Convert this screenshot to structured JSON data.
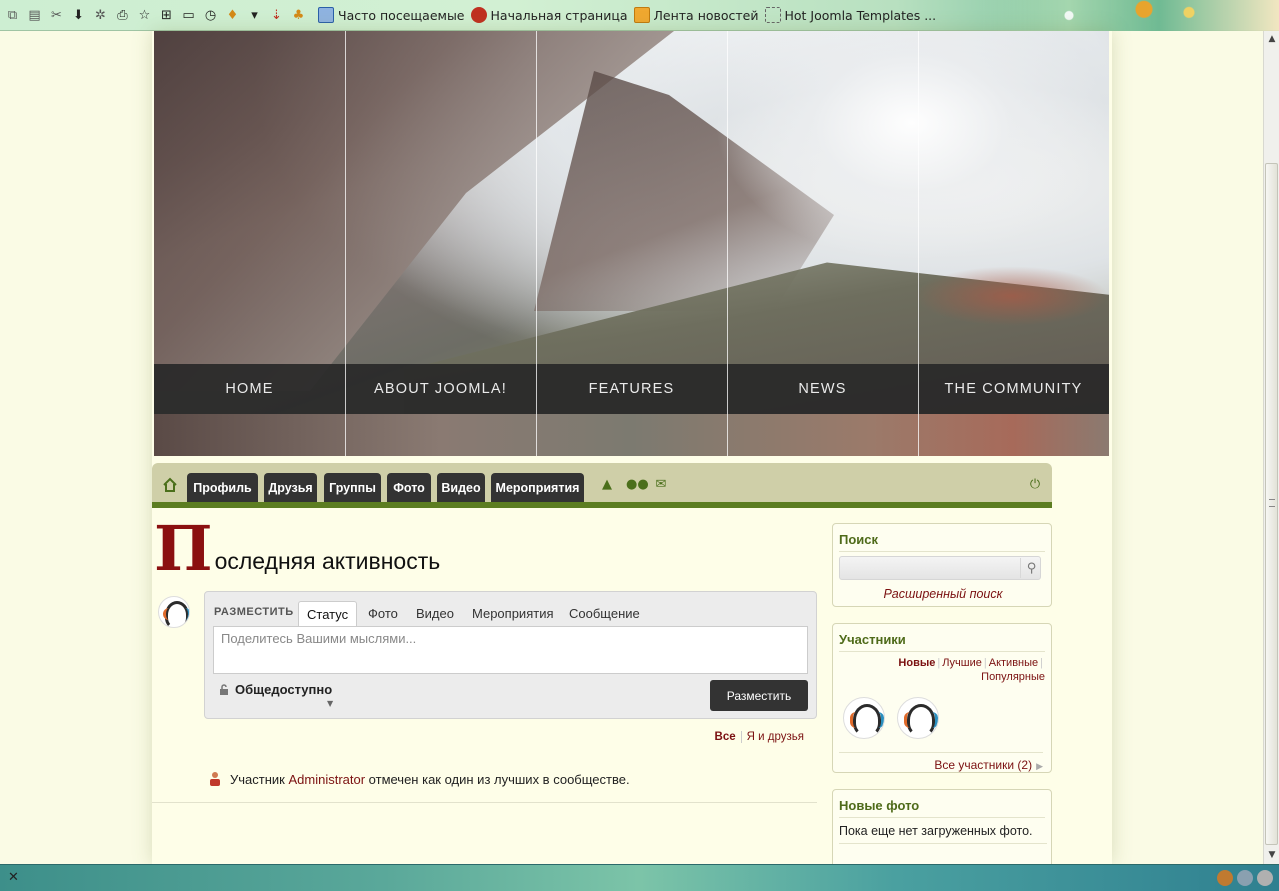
{
  "browser": {
    "bookmarks": [
      {
        "label": "Часто посещаемые",
        "icon": "folder-search-icon",
        "color": "#2a5fa8"
      },
      {
        "label": "Начальная страница",
        "icon": "joomla-logo-icon",
        "color": "#c03020"
      },
      {
        "label": "Лента новостей",
        "icon": "rss-icon",
        "color": "#d48a18"
      },
      {
        "label": "Hot Joomla Templates ...",
        "icon": "dashed-box-icon",
        "color": "#666666"
      }
    ]
  },
  "site": {
    "nav": [
      "HOME",
      "ABOUT JOOMLA!",
      "FEATURES",
      "NEWS",
      "THE COMMUNITY"
    ]
  },
  "js_toolbar": {
    "tabs": [
      "Профиль",
      "Друзья",
      "Группы",
      "Фото",
      "Видео",
      "Мероприятия"
    ]
  },
  "main": {
    "heading_initial": "П",
    "heading_rest": "оследняя активность",
    "composer": {
      "post_label": "РАЗМЕСТИТЬ",
      "tabs": [
        "Статус",
        "Фото",
        "Видео",
        "Мероприятия",
        "Сообщение"
      ],
      "active_tab": "Статус",
      "placeholder": "Поделитесь Вашими мыслями...",
      "privacy": "Общедоступно",
      "submit": "Разместить"
    },
    "filter": {
      "all": "Все",
      "me_friends": "Я и друзья"
    },
    "activity": {
      "prefix": "Участник",
      "user": "Administrator",
      "suffix": "отмечен как один из лучших в сообществе."
    }
  },
  "sidebar": {
    "search": {
      "title": "Поиск",
      "advanced": "Расширенный поиск"
    },
    "members": {
      "title": "Участники",
      "filters": [
        "Новые",
        "Лучшие",
        "Активные",
        "Популярные"
      ],
      "active_filter": "Новые",
      "all_link": "Все участники (2)"
    },
    "photos": {
      "title": "Новые фото",
      "empty": "Пока еще нет загруженных фото."
    }
  },
  "colors": {
    "accent_red": "#7b1111",
    "green": "#5c7d21",
    "toolbar_bg": "#cfcfa8",
    "page_bg": "#fefee8"
  }
}
